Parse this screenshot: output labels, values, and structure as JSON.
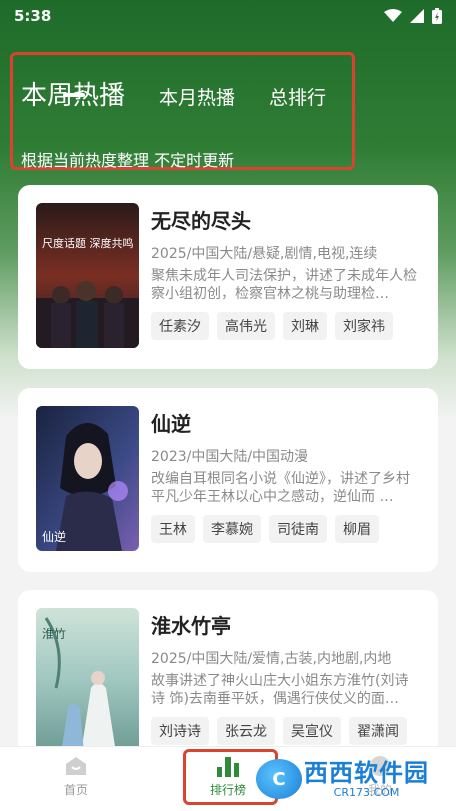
{
  "status": {
    "time": "5:38"
  },
  "tabs": [
    {
      "label": "本周热播",
      "active": true
    },
    {
      "label": "本月热播",
      "active": false
    },
    {
      "label": "总排行",
      "active": false
    }
  ],
  "subtitle": "根据当前热度整理 不定时更新",
  "items": [
    {
      "title": "无尽的尽头",
      "meta": "2025/中国大陆/悬疑,剧情,电视,连续",
      "desc": "聚焦未成年人司法保护，讲述了未成年人检察小组初创，检察官林之桃与助理检…",
      "cast": [
        "任素汐",
        "高伟光",
        "刘琳",
        "刘家祎"
      ],
      "poster_text": "尺度话题 深度共鸣",
      "poster_colors": [
        "#3a1f1a",
        "#7b2f23",
        "#1d1a24"
      ]
    },
    {
      "title": "仙逆",
      "meta": "2023/中国大陆/中国动漫",
      "desc": "改编自耳根同名小说《仙逆》，讲述了乡村平凡少年王林以心中之感动，逆仙而 …",
      "cast": [
        "王林",
        "李慕婉",
        "司徒南",
        "柳眉"
      ],
      "poster_text": "仙逆",
      "poster_colors": [
        "#1a2340",
        "#3b4a86",
        "#7a5fb0"
      ]
    },
    {
      "title": "淮水竹亭",
      "meta": "2025/中国大陆/爱情,古装,内地剧,内地",
      "desc": "故事讲述了神火山庄大小姐东方淮竹(刘诗诗 饰)去南垂平妖，偶遇行侠仗义的面…",
      "cast": [
        "刘诗诗",
        "张云龙",
        "吴宣仪",
        "翟潇闻"
      ],
      "poster_text": "淮竹",
      "poster_colors": [
        "#9fc7c0",
        "#cfe3d8",
        "#6d9a94"
      ]
    }
  ],
  "nav": {
    "home_label": "首页",
    "rank_label": "排行榜",
    "third_label": "我的"
  },
  "watermark": {
    "main": "西西软件园",
    "sub": "CR173.COM",
    "logo": "C"
  },
  "colors": {
    "accent": "#2e8b3a",
    "highlight_box": "#d9432f"
  }
}
